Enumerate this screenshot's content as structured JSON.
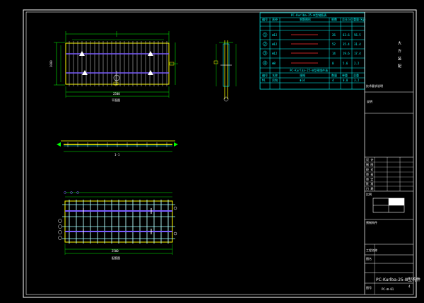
{
  "colors": {
    "background": "#000000",
    "frame": "#ffffff",
    "rebar_cyan": "#00ffff",
    "rebar_purple": "#7a5cff",
    "panel_yellow": "#ffff00",
    "dimension_green": "#00ff00",
    "table_red": "#ff3030"
  },
  "table": {
    "title": "PC-Kurlba-25-Ⅲ型钢筋表",
    "headers": [
      "编号",
      "直径",
      "钢筋图形",
      "根数",
      "总长(m)",
      "重量(kg)"
    ],
    "rows": [
      {
        "id": "1",
        "dia": "Φ12",
        "count": "26",
        "len": "63.6",
        "wt": "56.5"
      },
      {
        "id": "2",
        "dia": "Φ12",
        "count": "52",
        "len": "35.4",
        "wt": "31.4"
      },
      {
        "id": "3",
        "dia": "Φ12",
        "count": "14",
        "len": "19.6",
        "wt": "17.4"
      },
      {
        "id": "4",
        "dia": "Φ8",
        "count": "8",
        "len": "5.6",
        "wt": "2.2"
      }
    ],
    "subtitle": "PC-Kurlba-25-Ⅲ型预埋件表",
    "sub_headers": [
      "编号",
      "名称",
      "规格",
      "数量",
      "单重",
      "总重"
    ],
    "sub_row": [
      "M1",
      "吊钩",
      "Φ14",
      "4",
      "0.8",
      "3.2"
    ]
  },
  "side_text": "大 方 装 配",
  "notes": {
    "tech_header": "技术要求说明",
    "tech_label": "说明",
    "spec_label": "预制构件"
  },
  "views": {
    "plan_label": "平面图",
    "section_label": "1-1",
    "rebar_label": "配筋图",
    "plan_dim": "2500",
    "plan_dim_h": "1000",
    "rebar_dim": "2500"
  },
  "title_block": {
    "small_cells": [
      "设 计",
      "制 图",
      "校 对",
      "审 核",
      "审 定",
      "批 准",
      "日 期"
    ],
    "scale_label": "比例",
    "name_label": "图名",
    "project_label": "工程名称",
    "drawing_number": "PC-Kurlba-25-Ⅲ型构件",
    "sheet_label": "图号",
    "sheet_no": "PC-Ⅲ-01",
    "page": "4"
  }
}
